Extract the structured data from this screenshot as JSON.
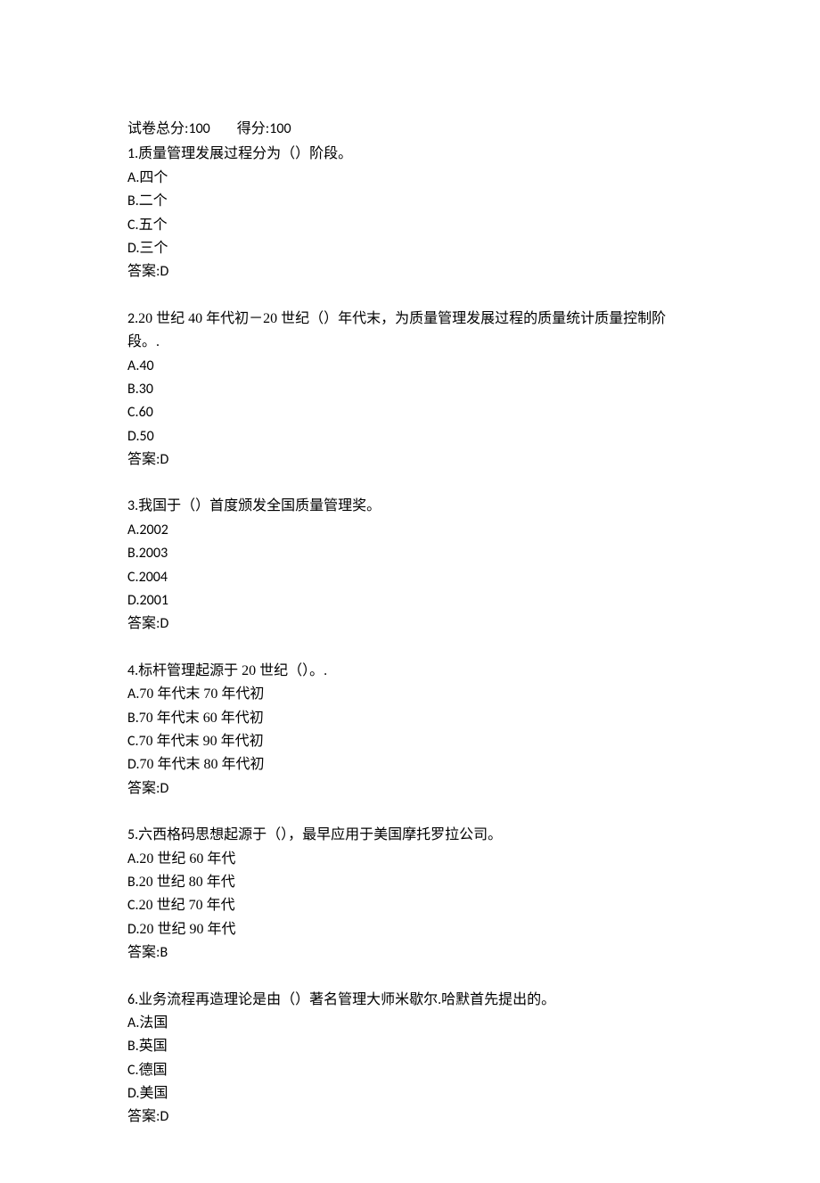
{
  "header": {
    "total_label": "试卷总分:",
    "total_value": "100",
    "score_label": "得分:",
    "score_value": "100"
  },
  "questions": [
    {
      "num": "1.",
      "text": "质量管理发展过程分为（）阶段。",
      "options": [
        {
          "letter": "A.",
          "text": "四个"
        },
        {
          "letter": "B.",
          "text": "二个"
        },
        {
          "letter": "C.",
          "text": "五个"
        },
        {
          "letter": "D.",
          "text": "三个"
        }
      ],
      "answer_label": "答案:",
      "answer": "D"
    },
    {
      "num": "2.",
      "pre": "20 世纪 40 年代初－20 世纪（）年代末，为质量管理发展过程的质量统计质量控制阶",
      "cont": "段。.",
      "options": [
        {
          "letter": "A.",
          "text": "40"
        },
        {
          "letter": "B.",
          "text": "30"
        },
        {
          "letter": "C.",
          "text": "60"
        },
        {
          "letter": "D.",
          "text": "50"
        }
      ],
      "answer_label": "答案:",
      "answer": "D"
    },
    {
      "num": "3.",
      "text": "我国于（）首度颁发全国质量管理奖。",
      "options": [
        {
          "letter": "A.",
          "text": "2002"
        },
        {
          "letter": "B.",
          "text": "2003"
        },
        {
          "letter": "C.",
          "text": "2004"
        },
        {
          "letter": "D.",
          "text": "2001"
        }
      ],
      "answer_label": "答案:",
      "answer": "D"
    },
    {
      "num": "4.",
      "text": "标杆管理起源于 20 世纪（）。.",
      "options": [
        {
          "letter": "A.",
          "text": "70 年代末 70 年代初"
        },
        {
          "letter": "B.",
          "text": "70 年代末 60 年代初"
        },
        {
          "letter": "C.",
          "text": "70 年代末 90 年代初"
        },
        {
          "letter": "D.",
          "text": "70 年代末 80 年代初"
        }
      ],
      "answer_label": "答案:",
      "answer": "D"
    },
    {
      "num": "5.",
      "text": "六西格码思想起源于（），最早应用于美国摩托罗拉公司。",
      "options": [
        {
          "letter": "A.",
          "text": "20 世纪 60 年代"
        },
        {
          "letter": "B.",
          "text": "20 世纪 80 年代"
        },
        {
          "letter": "C.",
          "text": "20 世纪 70 年代"
        },
        {
          "letter": "D.",
          "text": "20 世纪 90 年代"
        }
      ],
      "answer_label": "答案:",
      "answer": "B"
    },
    {
      "num": "6.",
      "text": "业务流程再造理论是由（）著名管理大师米歇尔.哈默首先提出的。",
      "options": [
        {
          "letter": "A.",
          "text": "法国"
        },
        {
          "letter": "B.",
          "text": "英国"
        },
        {
          "letter": "C.",
          "text": "德国"
        },
        {
          "letter": "D.",
          "text": "美国"
        }
      ],
      "answer_label": "答案:",
      "answer": "D"
    }
  ]
}
